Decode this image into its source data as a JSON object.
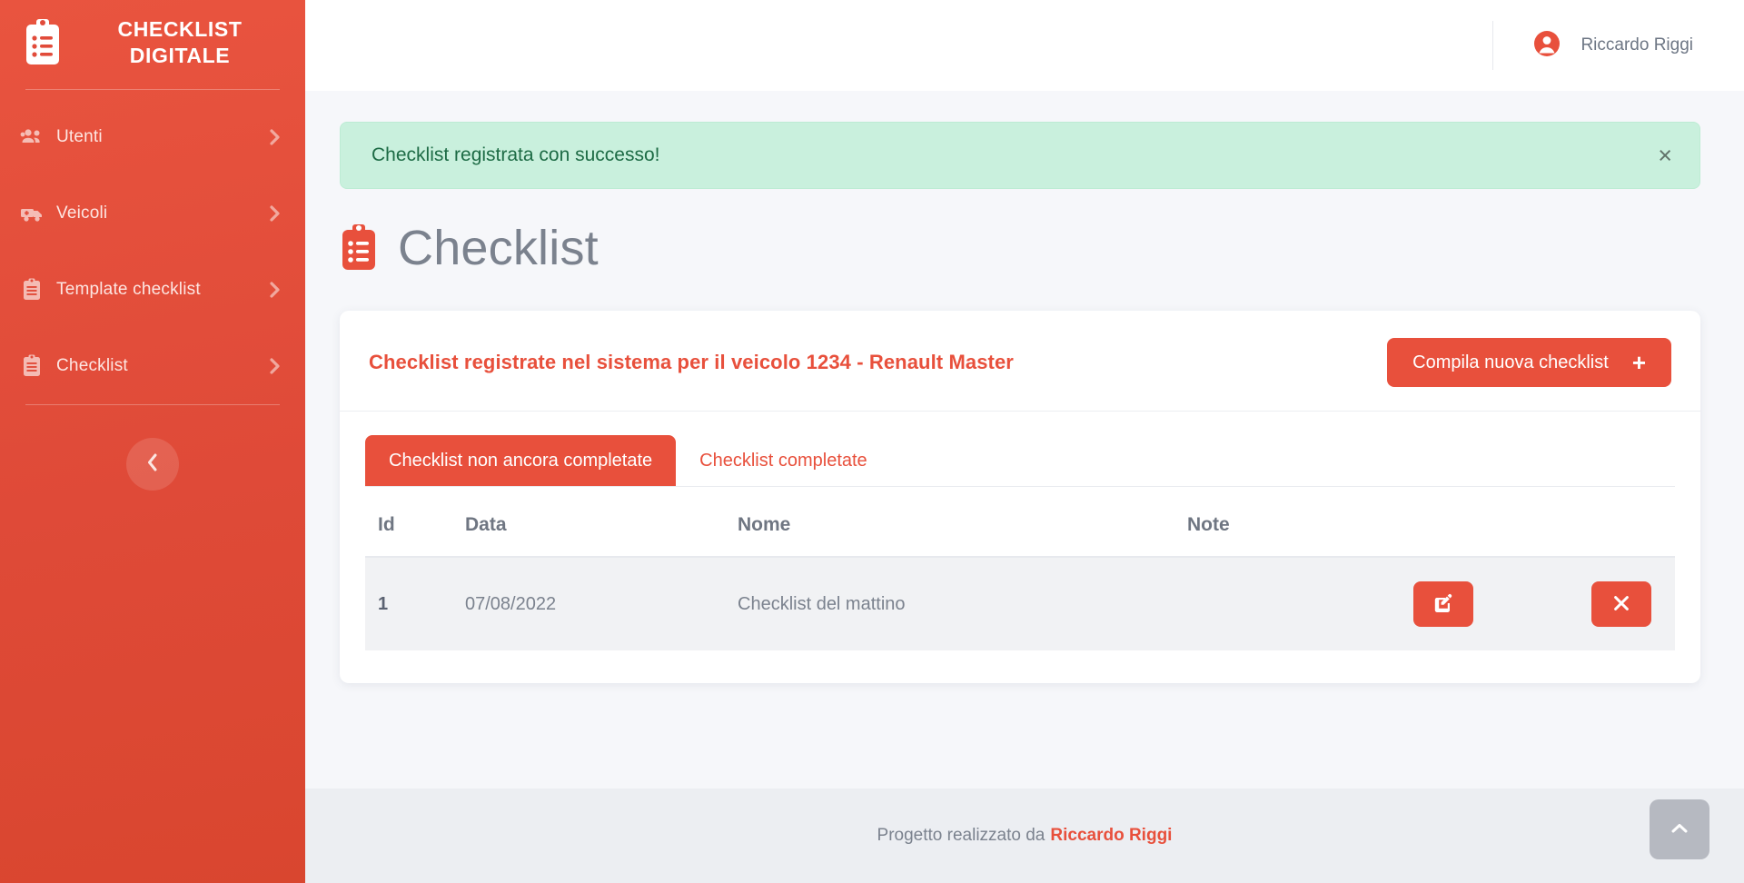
{
  "sidebar": {
    "brand_title": "CHECKLIST DIGITALE",
    "brand_icon": "clipboard-list-icon",
    "items": [
      {
        "label": "Utenti",
        "icon": "users-icon"
      },
      {
        "label": "Veicoli",
        "icon": "van-icon"
      },
      {
        "label": "Template checklist",
        "icon": "clipboard-icon"
      },
      {
        "label": "Checklist",
        "icon": "clipboard-icon"
      }
    ],
    "collapse_icon": "chevron-left-icon"
  },
  "topbar": {
    "user_name": "Riccardo Riggi",
    "user_icon": "user-circle-icon"
  },
  "alert": {
    "message": "Checklist registrata con successo!",
    "close_label": "×",
    "bg_color": "#c9f0dd",
    "text_color": "#1d6b45"
  },
  "page": {
    "title": "Checklist",
    "icon": "clipboard-list-icon"
  },
  "card": {
    "title": "Checklist registrate nel sistema per il veicolo 1234 - Renault Master",
    "new_button_label": "Compila nuova checklist",
    "new_button_icon": "plus-icon",
    "tabs": [
      {
        "label": "Checklist non ancora completate",
        "active": true
      },
      {
        "label": "Checklist completate",
        "active": false
      }
    ],
    "table": {
      "columns": [
        "Id",
        "Data",
        "Nome",
        "Note"
      ],
      "rows": [
        {
          "id": "1",
          "data": "07/08/2022",
          "nome": "Checklist del mattino",
          "note": "",
          "edit_icon": "edit-square-icon",
          "delete_icon": "close-x-icon"
        }
      ]
    }
  },
  "footer": {
    "text": "Progetto realizzato da",
    "author": "Riccardo Riggi"
  },
  "to_top": {
    "icon": "chevron-up-icon"
  },
  "colors": {
    "brand_red": "#e8503c",
    "sidebar_red": "#e14b3a",
    "page_bg": "#f6f7fa",
    "muted_text": "#7b828e"
  }
}
